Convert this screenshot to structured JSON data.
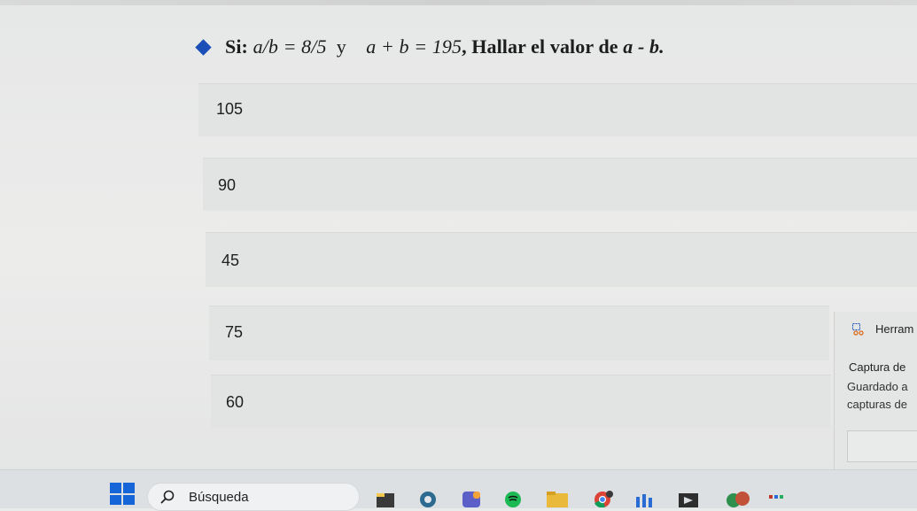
{
  "question": {
    "prefix": "Si: ",
    "condition1": "a/b = 8/5",
    "connector": "y",
    "condition2": "a + b = 195",
    "suffix": ", Hallar el valor de ",
    "target": "a - b."
  },
  "options": [
    {
      "label": "105"
    },
    {
      "label": "90"
    },
    {
      "label": "45"
    },
    {
      "label": "75"
    },
    {
      "label": "60"
    }
  ],
  "notification": {
    "app": "Herram",
    "title": "Captura de",
    "line1": "Guardado a",
    "line2": "capturas de"
  },
  "taskbar": {
    "search_label": "Búsqueda",
    "icons": [
      "windows-start-icon",
      "search-icon",
      "file-explorer-icon",
      "browser-icon",
      "teams-icon",
      "spotify-icon",
      "folder-icon",
      "chrome-icon",
      "app-icon",
      "app-icon",
      "app-icon",
      "app-icon"
    ]
  },
  "colors": {
    "accent": "#1a4fb8",
    "start": "#1565d8"
  }
}
